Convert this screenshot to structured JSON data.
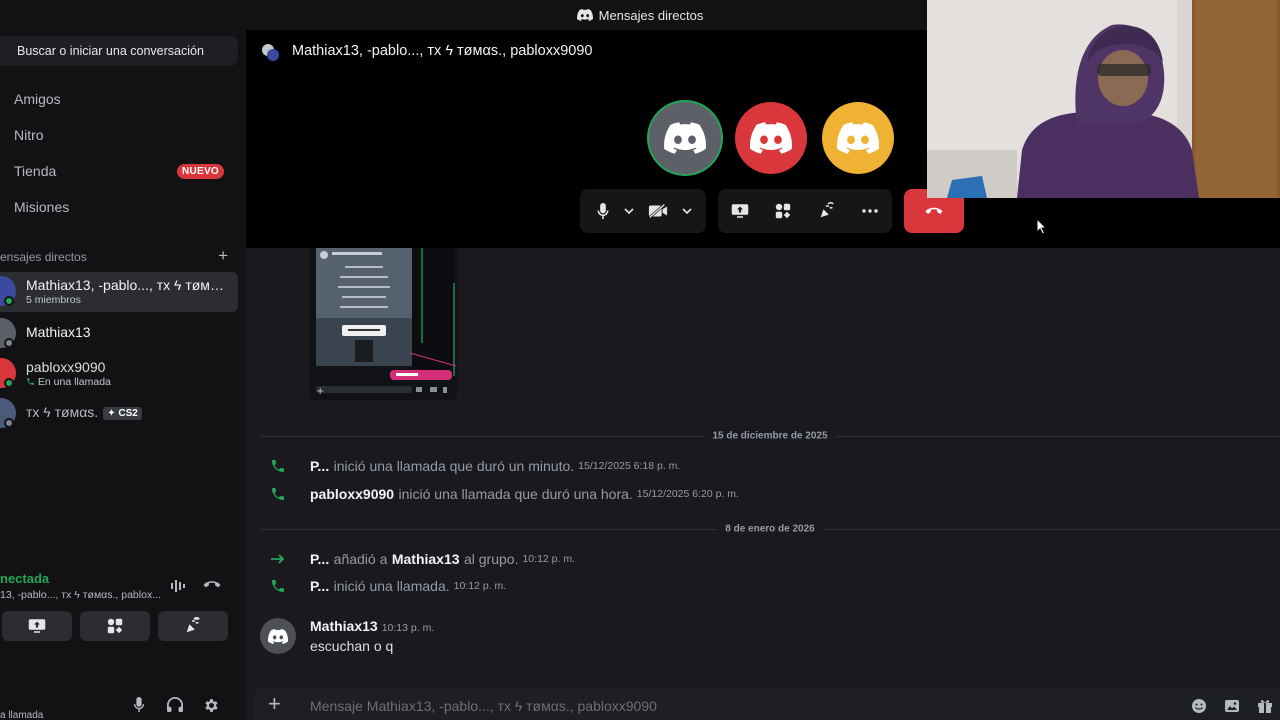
{
  "window": {
    "title": "Mensajes directos"
  },
  "sidebar": {
    "search_label": "Buscar o iniciar una conversación",
    "nav": [
      {
        "label": "Amigos"
      },
      {
        "label": "Nitro"
      },
      {
        "label": "Tienda",
        "badge": "NUEVO"
      },
      {
        "label": "Misiones"
      }
    ],
    "dm_header": "ensajes directos",
    "dms": [
      {
        "name": "Mathiax13, -pablo..., тx ϟ тøмαѕ., pabloxx9090",
        "sub": "5 miembros",
        "selected": true
      },
      {
        "name": "Mathiax13",
        "sub": ""
      },
      {
        "name": "pabloxx9090",
        "sub": "En una llamada"
      },
      {
        "name": "тx ϟ тøмαѕ.",
        "tag": "CS2"
      }
    ]
  },
  "voice_panel": {
    "status": "nectada",
    "channel": "13, -pablo..., тx ϟ тøмαѕ., pablox..."
  },
  "user_bar": {
    "status_text": "a llamada"
  },
  "call": {
    "title": "Mathiax13, -pablo..., тx ϟ тøмαѕ., pabloxx9090",
    "participant_colors": [
      "#5d6069",
      "#da373c",
      "#f0b232"
    ]
  },
  "chat": {
    "dividers": [
      "15 de diciembre de 2025",
      "8 de enero de 2026"
    ],
    "call_events": [
      {
        "actor": "P...",
        "text": "inició una llamada que duró un minuto.",
        "time": "15/12/2025 6:18 p. m."
      },
      {
        "actor": "pabloxx9090",
        "text": "inició una llamada que duró una hora.",
        "time": "15/12/2025 6:20 p. m."
      }
    ],
    "join_event": {
      "actor": "P...",
      "verb": "añadió a",
      "target": "Mathiax13",
      "suffix": "al grupo.",
      "time": "10:12 p. m."
    },
    "call_event_2": {
      "actor": "P...",
      "text": "inició una llamada.",
      "time": "10:12 p. m."
    },
    "message": {
      "author": "Mathiax13",
      "time": "10:13 p. m.",
      "text": "escuchan o q"
    }
  },
  "composer": {
    "placeholder": "Mensaje Mathiax13, -pablo..., тx ϟ тøмαѕ., pabloxx9090"
  },
  "colors": {
    "online": "#23a55a",
    "danger": "#da373c",
    "blurple": "#5865f2"
  }
}
